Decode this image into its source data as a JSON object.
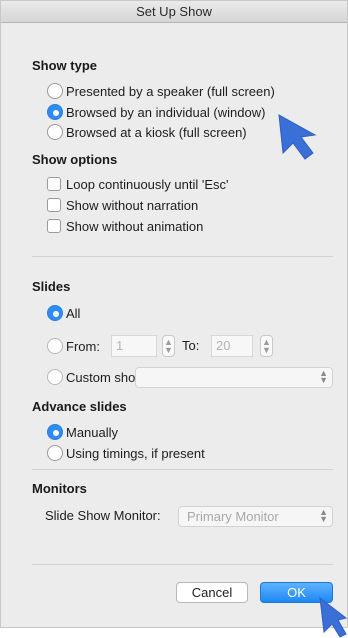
{
  "window": {
    "title": "Set Up Show"
  },
  "show_type": {
    "heading": "Show type",
    "options": [
      {
        "label": "Presented by a speaker (full screen)",
        "selected": false
      },
      {
        "label": "Browsed by an individual (window)",
        "selected": true
      },
      {
        "label": "Browsed at a kiosk (full screen)",
        "selected": false
      }
    ]
  },
  "show_options": {
    "heading": "Show options",
    "options": [
      {
        "label": "Loop continuously until 'Esc'",
        "checked": false
      },
      {
        "label": "Show without narration",
        "checked": false
      },
      {
        "label": "Show without animation",
        "checked": false
      }
    ]
  },
  "slides": {
    "heading": "Slides",
    "all_label": "All",
    "from_label": "From:",
    "from_value": "1",
    "to_label": "To:",
    "to_value": "20",
    "custom_label": "Custom show:",
    "custom_value": "",
    "selected": "All"
  },
  "advance": {
    "heading": "Advance slides",
    "options": [
      {
        "label": "Manually",
        "selected": true
      },
      {
        "label": "Using timings, if present",
        "selected": false
      }
    ]
  },
  "monitors": {
    "heading": "Monitors",
    "label": "Slide Show Monitor:",
    "value": "Primary Monitor"
  },
  "buttons": {
    "cancel": "Cancel",
    "ok": "OK"
  },
  "colors": {
    "accent": "#2f8cf4",
    "cursor": "#3a6fd8"
  }
}
